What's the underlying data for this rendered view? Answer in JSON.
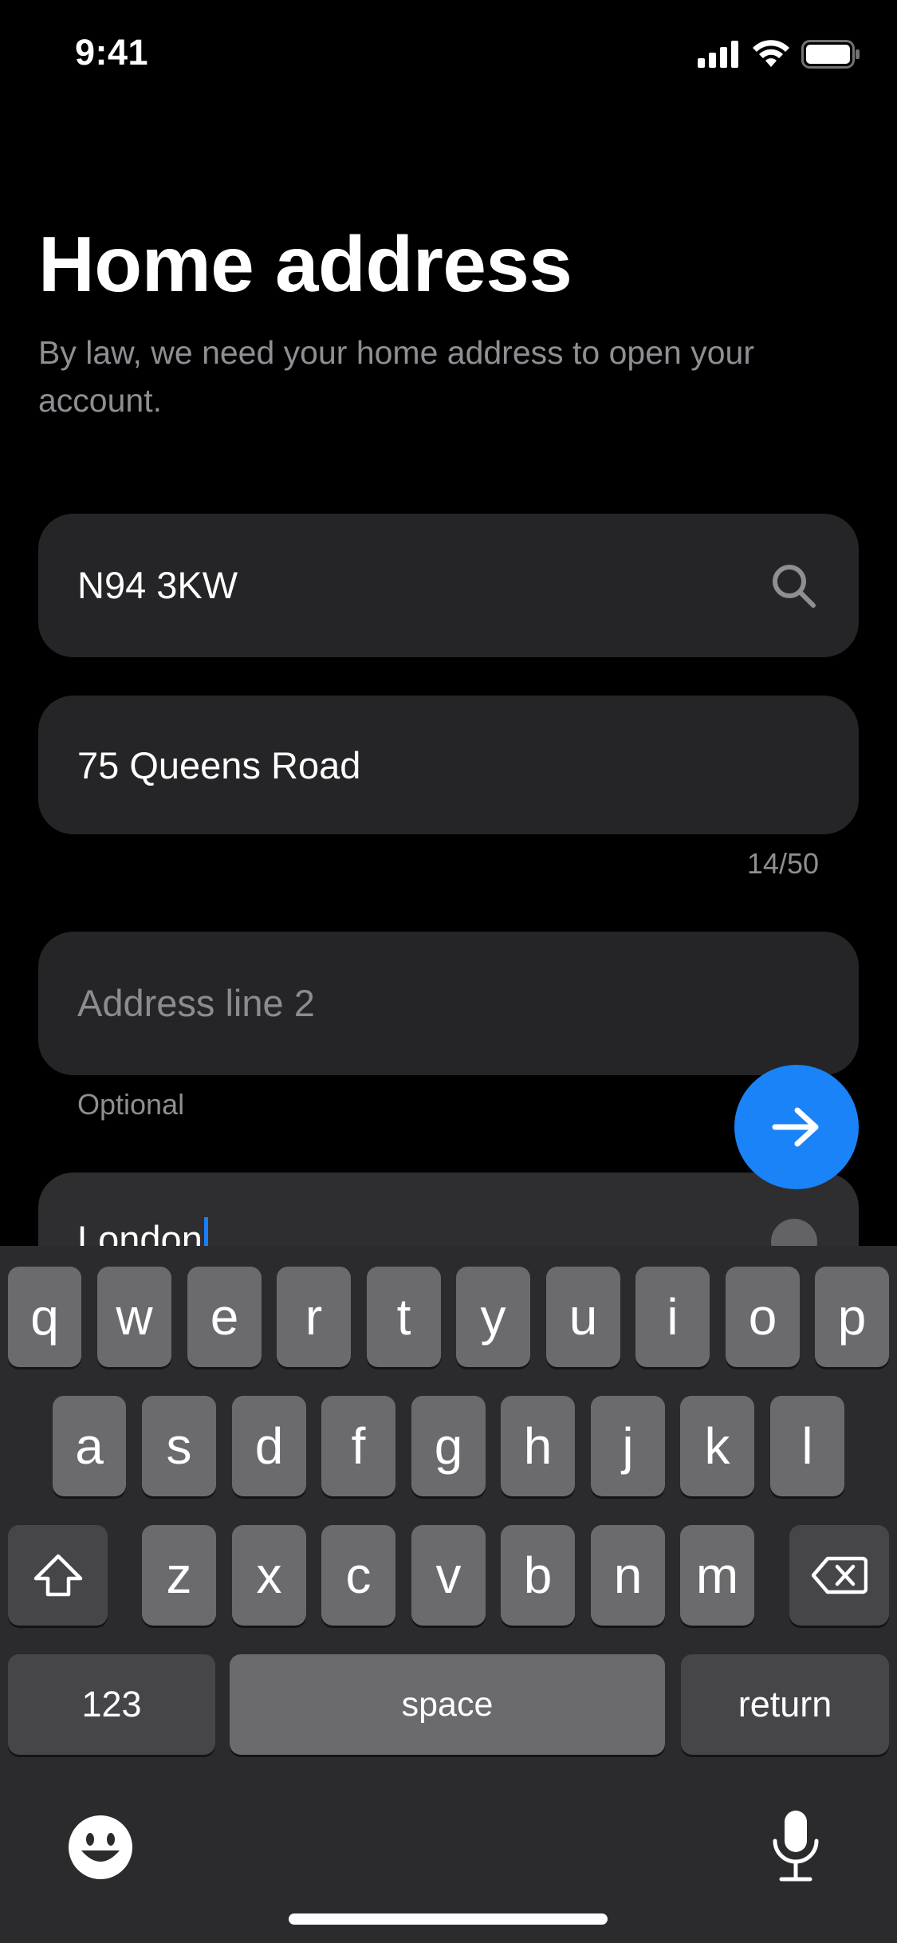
{
  "status_bar": {
    "time": "9:41",
    "icons": [
      "cellular-signal-icon",
      "wifi-icon",
      "battery-icon"
    ]
  },
  "header": {
    "title": "Home address",
    "subtitle": "By law, we need your home address to open your account."
  },
  "form": {
    "postcode": {
      "value": "N94 3KW",
      "icon": "search-icon"
    },
    "address_line_1": {
      "value": "75 Queens Road",
      "counter": "14/50"
    },
    "address_line_2": {
      "placeholder": "Address line 2",
      "helper": "Optional"
    },
    "city": {
      "value": "London",
      "icon": "clear-icon"
    }
  },
  "next_button": {
    "icon": "arrow-right-icon",
    "color": "#1a83f7"
  },
  "keyboard": {
    "row1": [
      "q",
      "w",
      "e",
      "r",
      "t",
      "y",
      "u",
      "i",
      "o",
      "p"
    ],
    "row2": [
      "a",
      "s",
      "d",
      "f",
      "g",
      "h",
      "j",
      "k",
      "l"
    ],
    "row3": [
      "z",
      "x",
      "c",
      "v",
      "b",
      "n",
      "m"
    ],
    "numbers_label": "123",
    "space_label": "space",
    "return_label": "return",
    "icons": [
      "shift-icon",
      "backspace-icon",
      "emoji-icon",
      "microphone-icon"
    ]
  },
  "colors": {
    "background": "#000000",
    "field": "#252527",
    "accent": "#1a83f7",
    "muted_text": "#8e8e93"
  }
}
